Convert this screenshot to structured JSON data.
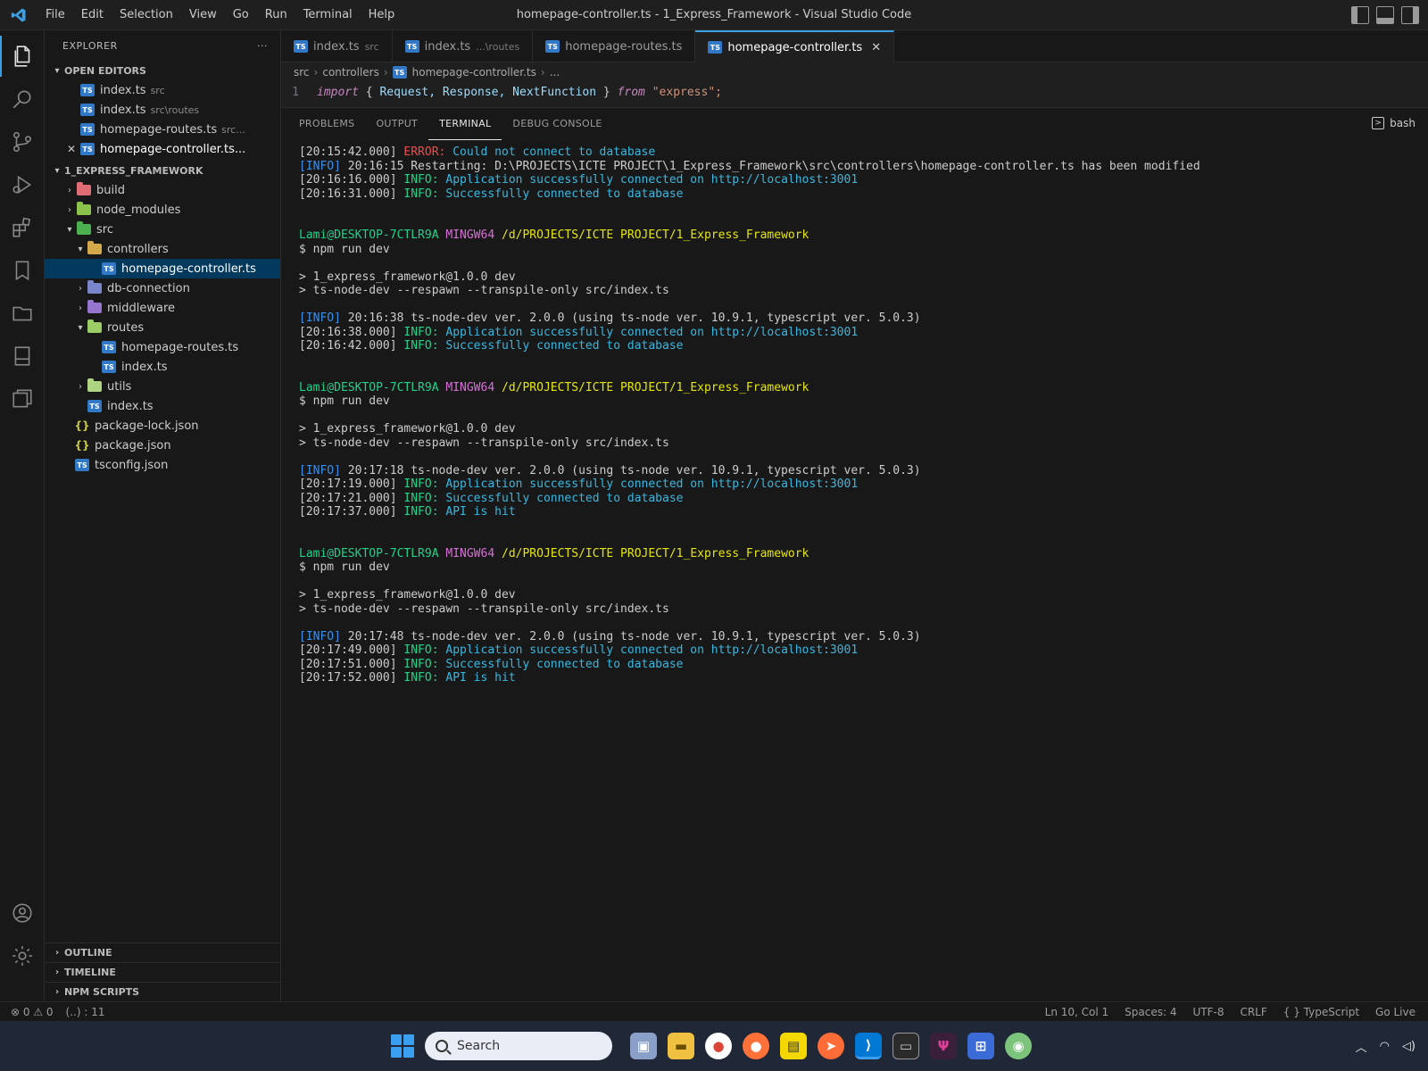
{
  "window": {
    "title": "homepage-controller.ts - 1_Express_Framework - Visual Studio Code",
    "menu": [
      "File",
      "Edit",
      "Selection",
      "View",
      "Go",
      "Run",
      "Terminal",
      "Help"
    ]
  },
  "sidebar": {
    "header": "EXPLORER",
    "more": "···",
    "open_editors_title": "OPEN EDITORS",
    "open_editors": [
      {
        "name": "index.ts",
        "desc": "src"
      },
      {
        "name": "index.ts",
        "desc": "src\\routes"
      },
      {
        "name": "homepage-routes.ts",
        "desc": "src..."
      },
      {
        "name": "homepage-controller.ts...",
        "desc": ""
      }
    ],
    "project_title": "1_EXPRESS_FRAMEWORK",
    "tree": {
      "build": "build",
      "node_modules": "node_modules",
      "src": "src",
      "controllers": "controllers",
      "controller_file": "homepage-controller.ts",
      "db_connection": "db-connection",
      "middleware": "middleware",
      "routes": "routes",
      "routes_file1": "homepage-routes.ts",
      "routes_file2": "index.ts",
      "utils": "utils",
      "src_index": "index.ts",
      "package_lock": "package-lock.json",
      "package": "package.json",
      "tsconfig": "tsconfig.json"
    },
    "bottom_sections": [
      "OUTLINE",
      "TIMELINE",
      "NPM SCRIPTS"
    ]
  },
  "tabs": [
    {
      "name": "index.ts",
      "desc": "src"
    },
    {
      "name": "index.ts",
      "desc": "...\\routes"
    },
    {
      "name": "homepage-routes.ts",
      "desc": ""
    },
    {
      "name": "homepage-controller.ts",
      "desc": "",
      "close": "✕"
    }
  ],
  "breadcrumb": [
    "src",
    "controllers",
    "homepage-controller.ts",
    "..."
  ],
  "code": {
    "line_number": "1",
    "kw_import": "import",
    "brace_open": " { ",
    "ids": "Request, Response, NextFunction",
    "brace_close": " } ",
    "kw_from": "from",
    "module": " \"express\";"
  },
  "panel": {
    "tabs": [
      "PROBLEMS",
      "OUTPUT",
      "TERMINAL",
      "DEBUG CONSOLE"
    ],
    "shell": "bash"
  },
  "terminal": {
    "l1_ts": "[20:15:42.000] ",
    "l1_level": "ERROR:",
    "l1_msg": " Could not connect to database",
    "l2_tag": "[INFO]",
    "l2_msg": " 20:16:15 Restarting: D:\\PROJECTS\\ICTE PROJECT\\1_Express_Framework\\src\\controllers\\homepage-controller.ts has been modified",
    "l3_ts": "[20:16:16.000] ",
    "l3_level": "INFO:",
    "l3_msg": " Application successfully connected on ",
    "l3_url": "http://localhost:3001",
    "l4_ts": "[20:16:31.000] ",
    "l4_level": "INFO:",
    "l4_msg": " Successfully connected to database",
    "p1_user": "Lami@DESKTOP-7CTLR9A",
    "p1_env": " MINGW64",
    "p1_path": " /d/PROJECTS/ICTE PROJECT/1_Express_Framework",
    "p1_cmd": "$ npm run dev",
    "r1_a": "> 1_express_framework@1.0.0 dev",
    "r1_b": "> ts-node-dev --respawn --transpile-only src/index.ts",
    "b1_tag": "[INFO]",
    "b1_msg": " 20:16:38 ts-node-dev ver. 2.0.0 (using ts-node ver. 10.9.1, typescript ver. 5.0.3)",
    "b1_l2_ts": "[20:16:38.000] ",
    "b1_l2_level": "INFO:",
    "b1_l2_msg": " Application successfully connected on ",
    "b1_l2_url": "http://localhost:3001",
    "b1_l3_ts": "[20:16:42.000] ",
    "b1_l3_level": "INFO:",
    "b1_l3_msg": " Successfully connected to database",
    "p2_user": "Lami@DESKTOP-7CTLR9A",
    "p2_env": " MINGW64",
    "p2_path": " /d/PROJECTS/ICTE PROJECT/1_Express_Framework",
    "p2_cmd": "$ npm run dev",
    "r2_a": "> 1_express_framework@1.0.0 dev",
    "r2_b": "> ts-node-dev --respawn --transpile-only src/index.ts",
    "b2_tag": "[INFO]",
    "b2_msg": " 20:17:18 ts-node-dev ver. 2.0.0 (using ts-node ver. 10.9.1, typescript ver. 5.0.3)",
    "b2_l2_ts": "[20:17:19.000] ",
    "b2_l2_level": "INFO:",
    "b2_l2_msg": " Application successfully connected on ",
    "b2_l2_url": "http://localhost:3001",
    "b2_l3_ts": "[20:17:21.000] ",
    "b2_l3_level": "INFO:",
    "b2_l3_msg": " Successfully connected to database",
    "b2_l4_ts": "[20:17:37.000] ",
    "b2_l4_level": "INFO:",
    "b2_l4_msg": " API is hit",
    "p3_user": "Lami@DESKTOP-7CTLR9A",
    "p3_env": " MINGW64",
    "p3_path": " /d/PROJECTS/ICTE PROJECT/1_Express_Framework",
    "p3_cmd": "$ npm run dev",
    "r3_a": "> 1_express_framework@1.0.0 dev",
    "r3_b": "> ts-node-dev --respawn --transpile-only src/index.ts",
    "b3_tag": "[INFO]",
    "b3_msg": " 20:17:48 ts-node-dev ver. 2.0.0 (using ts-node ver. 10.9.1, typescript ver. 5.0.3)",
    "b3_l2_ts": "[20:17:49.000] ",
    "b3_l2_level": "INFO:",
    "b3_l2_msg": " Application successfully connected on ",
    "b3_l2_url": "http://localhost:3001",
    "b3_l3_ts": "[20:17:51.000] ",
    "b3_l3_level": "INFO:",
    "b3_l3_msg": " Successfully connected to database",
    "b3_l4_ts": "[20:17:52.000] ",
    "b3_l4_level": "INFO:",
    "b3_l4_msg": " API is hit"
  },
  "statusbar": {
    "problems": "⊗ 0 ⚠ 0",
    "ports": "(..) : 11",
    "position": "Ln 10, Col 1",
    "spaces": "Spaces: 4",
    "encoding": "UTF-8",
    "eol": "CRLF",
    "language": "{ } TypeScript",
    "golive": "Go Live"
  },
  "taskbar": {
    "search_placeholder": "Search"
  },
  "colors": {
    "accent": "#3b9fe6",
    "error": "#f14c4c",
    "info": "#23d18b",
    "prompt_user": "#23d18b",
    "prompt_env": "#d670d6",
    "prompt_path": "#e5e510"
  }
}
